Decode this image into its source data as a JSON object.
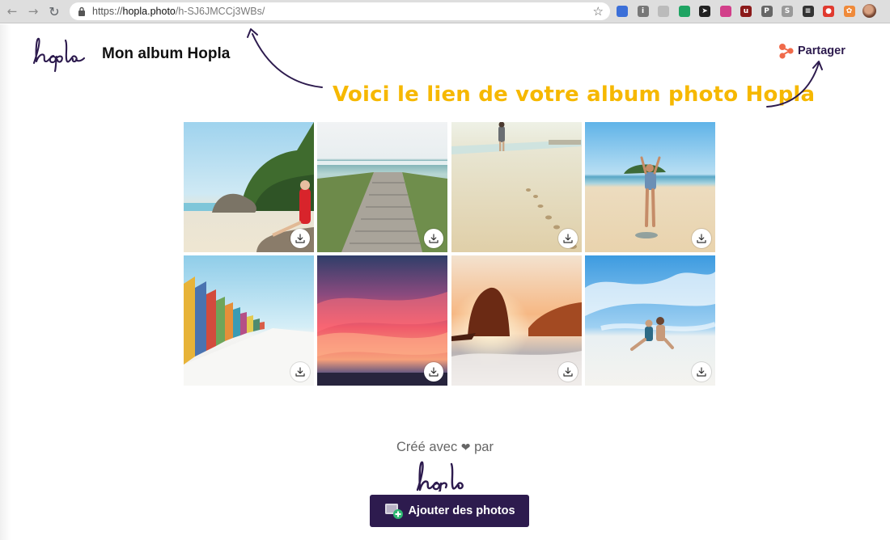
{
  "browser": {
    "url_prefix": "https://",
    "url_host": "hopla.photo",
    "url_path": "/h-SJ6JMCCj3WBs/",
    "back_icon": "arrow-left-icon",
    "forward_icon": "arrow-right-icon",
    "reload_icon": "reload-icon",
    "bookmark_icon": "star-icon",
    "extensions": [
      {
        "name": "ext-blue-square-icon",
        "color": "#3b6fd8",
        "glyph": ""
      },
      {
        "name": "ext-circle-info-icon",
        "color": "#777777",
        "glyph": "i"
      },
      {
        "name": "ext-grey-box-icon",
        "color": "#bbbbbb",
        "glyph": ""
      },
      {
        "name": "google-drive-icon",
        "color": "#1fa463",
        "glyph": ""
      },
      {
        "name": "cursor-icon",
        "color": "#222222",
        "glyph": "➤"
      },
      {
        "name": "color-wheel-icon",
        "color": "#d23f8a",
        "glyph": ""
      },
      {
        "name": "ublock-icon",
        "color": "#8b1a1a",
        "glyph": "u"
      },
      {
        "name": "pinterest-icon",
        "color": "#666666",
        "glyph": "P"
      },
      {
        "name": "s-icon",
        "color": "#999999",
        "glyph": "S"
      },
      {
        "name": "buffer-icon",
        "color": "#333333",
        "glyph": "≡"
      },
      {
        "name": "toggl-icon",
        "color": "#e03a2f",
        "glyph": "●"
      },
      {
        "name": "colorful-flower-icon",
        "color": "#ef8a3a",
        "glyph": "✿"
      }
    ]
  },
  "header": {
    "album_title": "Mon album Hopla",
    "share_label": "Partager",
    "share_icon": "share-nodes-icon",
    "logo": "hopla-logo"
  },
  "annotation": {
    "text": "Voici le lien de votre album photo Hopla",
    "color": "#f6b800"
  },
  "photos": [
    {
      "name": "photo-woman-red-dress-rocks",
      "download_icon": "download-icon"
    },
    {
      "name": "photo-wooden-path-beach",
      "download_icon": "download-icon"
    },
    {
      "name": "photo-person-walking-sand",
      "download_icon": "download-icon"
    },
    {
      "name": "photo-woman-arms-up-beach",
      "download_icon": "download-icon"
    },
    {
      "name": "photo-colorful-beach-huts",
      "download_icon": "download-icon"
    },
    {
      "name": "photo-pink-sunset-sky",
      "download_icon": "download-icon"
    },
    {
      "name": "photo-sunset-rock-sea",
      "download_icon": "download-icon"
    },
    {
      "name": "photo-couple-sitting-beach",
      "download_icon": "download-icon"
    }
  ],
  "footer": {
    "created_with_before": "Créé avec",
    "heart": "❤",
    "created_with_after": "par",
    "add_photos_label": "Ajouter des photos",
    "add_photos_icon": "add-photos-icon",
    "button_color": "#2d1b4e"
  }
}
